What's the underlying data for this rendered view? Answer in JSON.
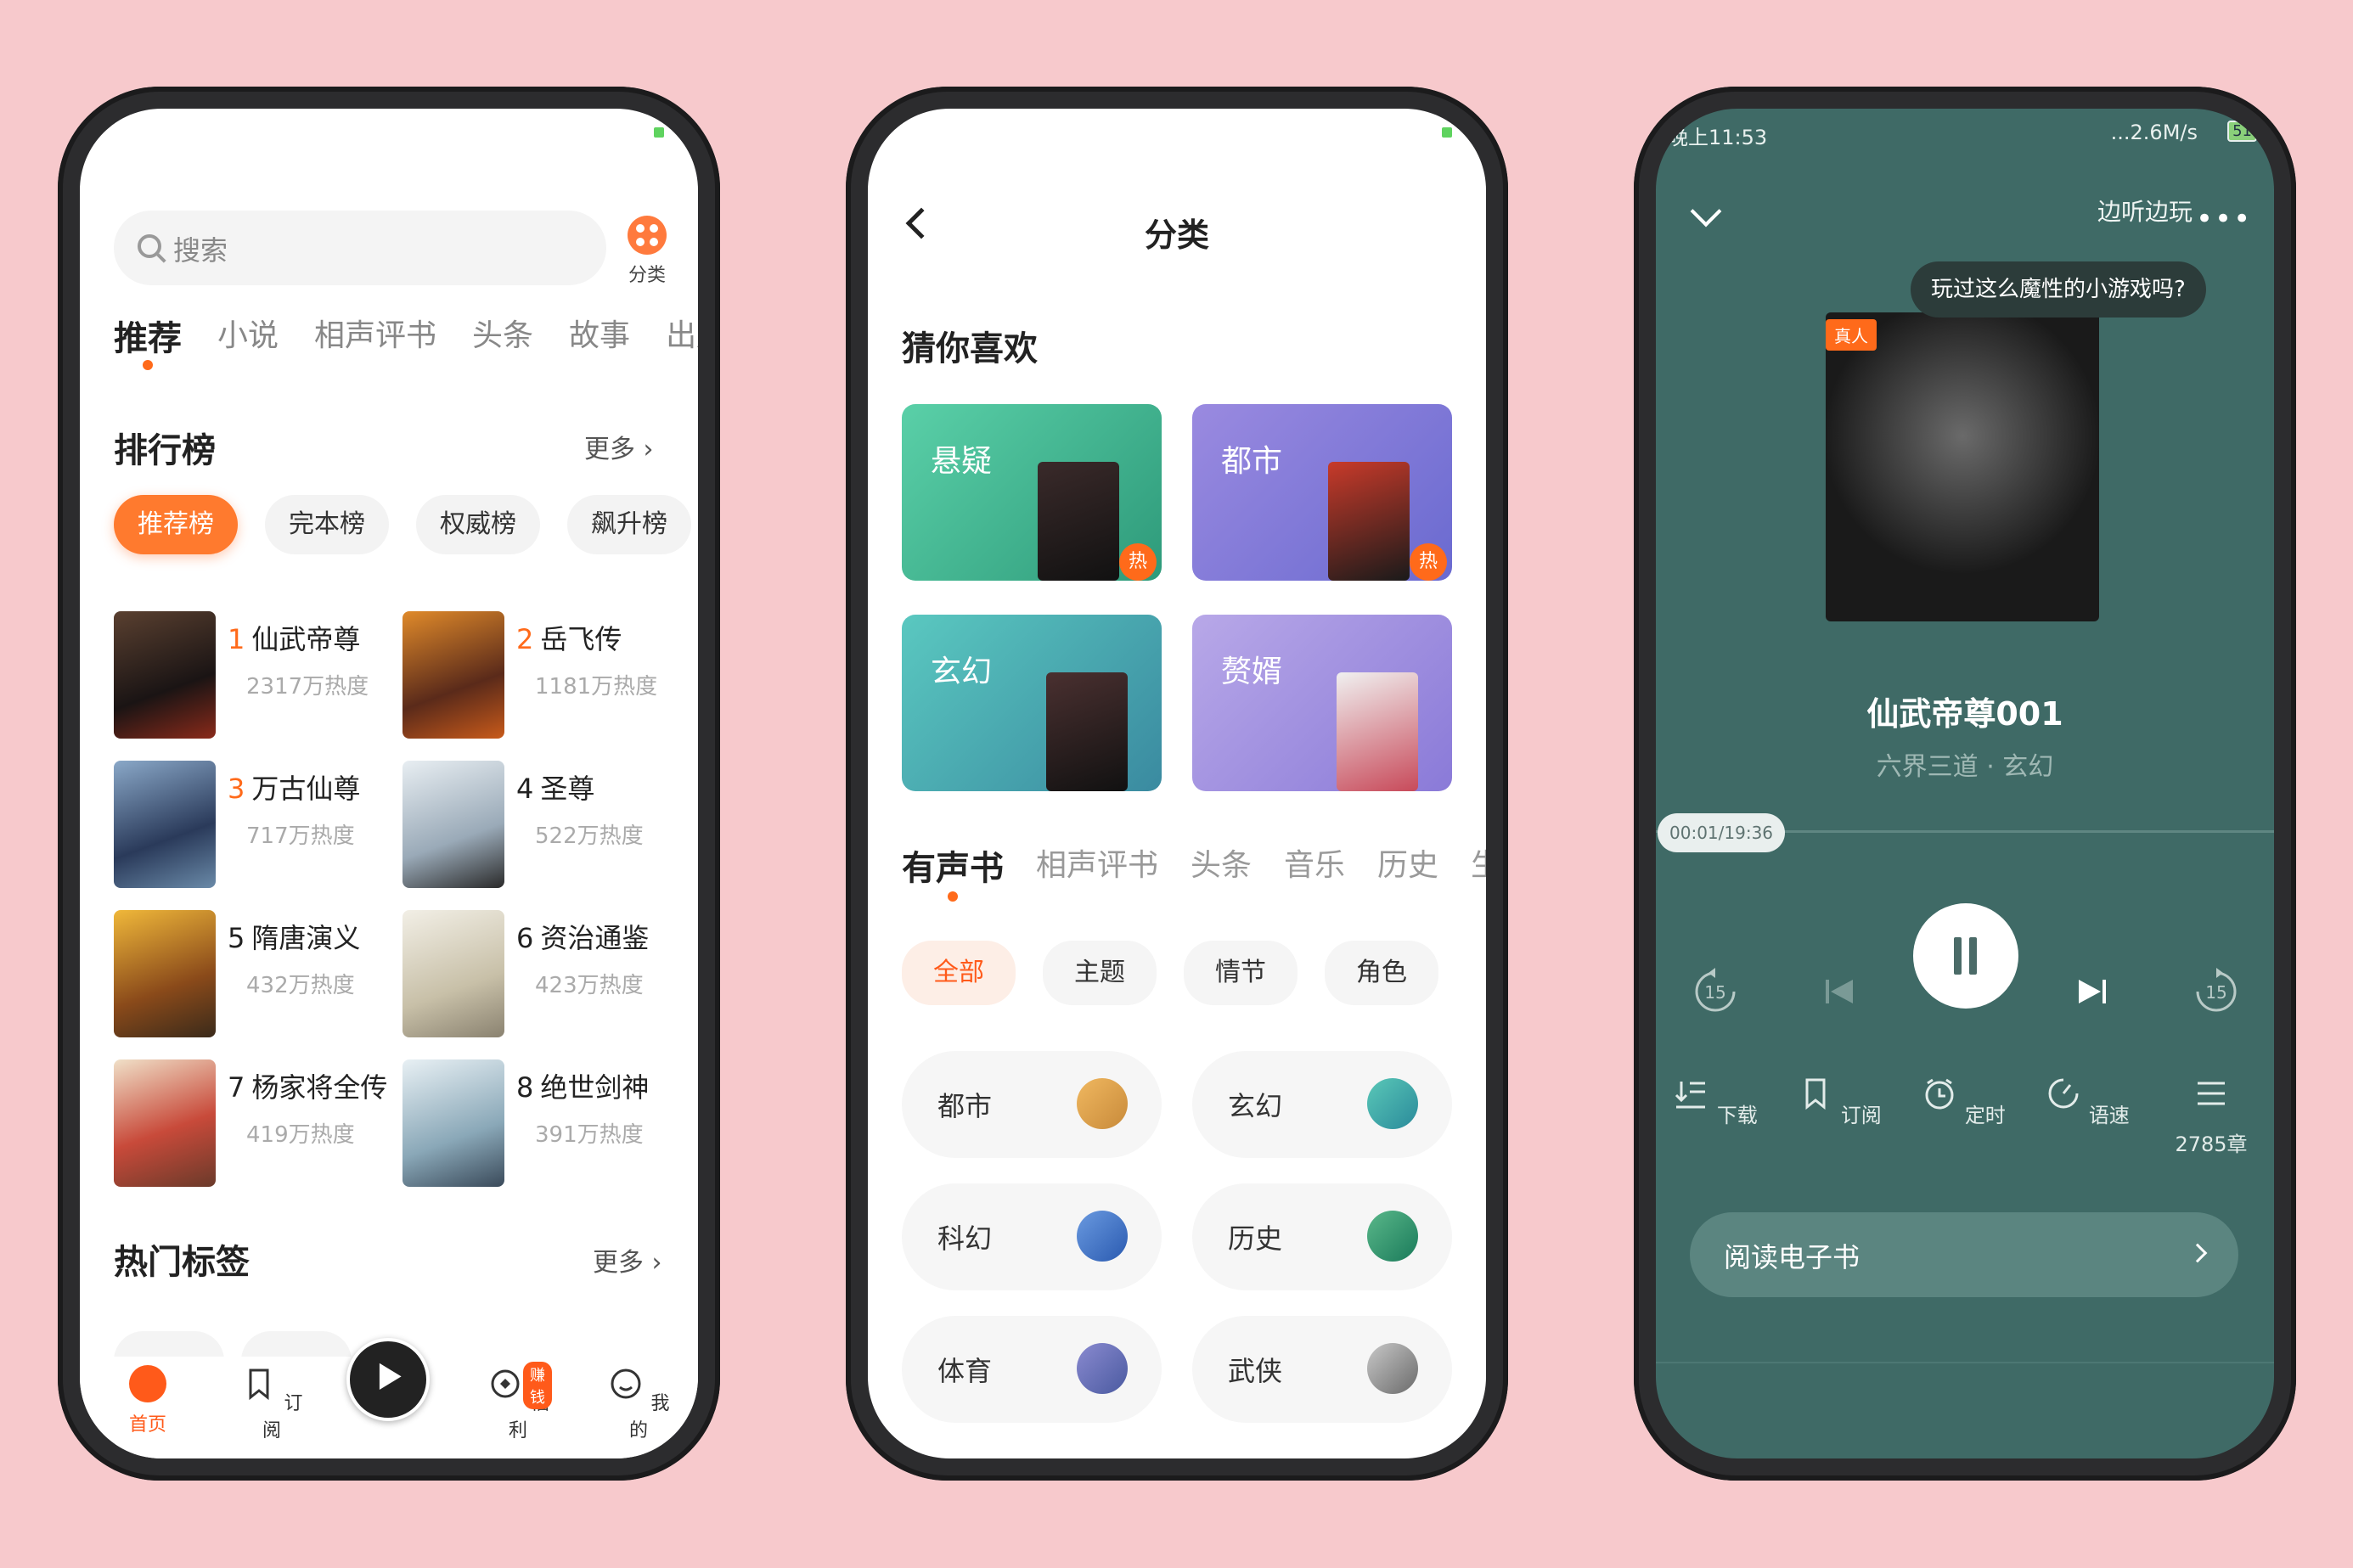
{
  "phone1": {
    "search_placeholder": "搜索",
    "category_label": "分类",
    "tabs": [
      "推荐",
      "小说",
      "相声评书",
      "头条",
      "故事",
      "出版物"
    ],
    "ranking": {
      "title": "排行榜",
      "more": "更多",
      "chips": [
        "推荐榜",
        "完本榜",
        "权威榜",
        "飙升榜"
      ],
      "items": [
        {
          "rank": "1",
          "name": "仙武帝尊",
          "heat": "2317万热度"
        },
        {
          "rank": "2",
          "name": "岳飞传",
          "heat": "1181万热度"
        },
        {
          "rank": "3",
          "name": "万古仙尊",
          "heat": "717万热度"
        },
        {
          "rank": "4",
          "name": "圣尊",
          "heat": "522万热度"
        },
        {
          "rank": "5",
          "name": "隋唐演义",
          "heat": "432万热度"
        },
        {
          "rank": "6",
          "name": "资治通鉴",
          "heat": "423万热度"
        },
        {
          "rank": "7",
          "name": "杨家将全传",
          "heat": "419万热度"
        },
        {
          "rank": "8",
          "name": "绝世剑神",
          "heat": "391万热度"
        }
      ]
    },
    "hot_tags": {
      "title": "热门标签",
      "more": "更多"
    },
    "tabbar": {
      "home": "首页",
      "subscribe": "订阅",
      "welfare": "福利",
      "welfare_badge": "赚钱",
      "mine": "我的"
    }
  },
  "phone2": {
    "title": "分类",
    "guess_title": "猜你喜欢",
    "guess_cards": [
      {
        "label": "悬疑",
        "hot": "热"
      },
      {
        "label": "都市",
        "hot": "热"
      },
      {
        "label": "玄幻"
      },
      {
        "label": "赘婿"
      }
    ],
    "tabs": [
      "有声书",
      "相声评书",
      "头条",
      "音乐",
      "历史",
      "生活"
    ],
    "chips": [
      "全部",
      "主题",
      "情节",
      "角色"
    ],
    "genres": [
      "都市",
      "玄幻",
      "科幻",
      "历史",
      "体育",
      "武侠"
    ]
  },
  "phone3": {
    "status_time": "晚上11:53",
    "status_speed": "...2.6M/s",
    "status_battery": "51",
    "listen_play": "边听边玩",
    "bubble": "玩过这么魔性的小游戏吗?",
    "tag_real": "真人",
    "track_title": "仙武帝尊001",
    "subtitle": "六界三道 · 玄幻",
    "progress_time": "00:01/19:36",
    "progress_fraction": 0.001,
    "skip_seconds": "15",
    "tools": [
      "下载",
      "订阅",
      "定时",
      "语速",
      "2785章"
    ],
    "read_ebook": "阅读电子书"
  }
}
